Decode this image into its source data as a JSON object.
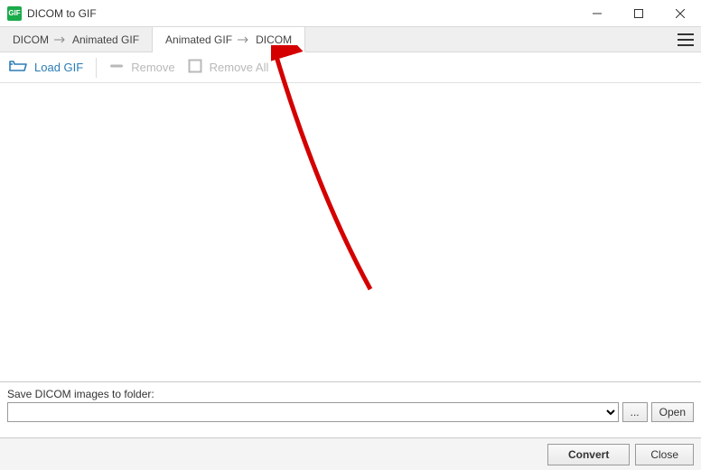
{
  "window": {
    "title": "DICOM to GIF",
    "app_icon_text": "GIF"
  },
  "tabs": [
    {
      "from": "DICOM",
      "to": "Animated GIF",
      "active": false
    },
    {
      "from": "Animated GIF",
      "to": "DICOM",
      "active": true
    }
  ],
  "toolbar": {
    "load_label": "Load GIF",
    "remove_label": "Remove",
    "remove_all_label": "Remove All"
  },
  "save": {
    "label": "Save DICOM images to folder:",
    "path": "",
    "browse_label": "...",
    "open_label": "Open"
  },
  "actions": {
    "convert_label": "Convert",
    "close_label": "Close"
  }
}
